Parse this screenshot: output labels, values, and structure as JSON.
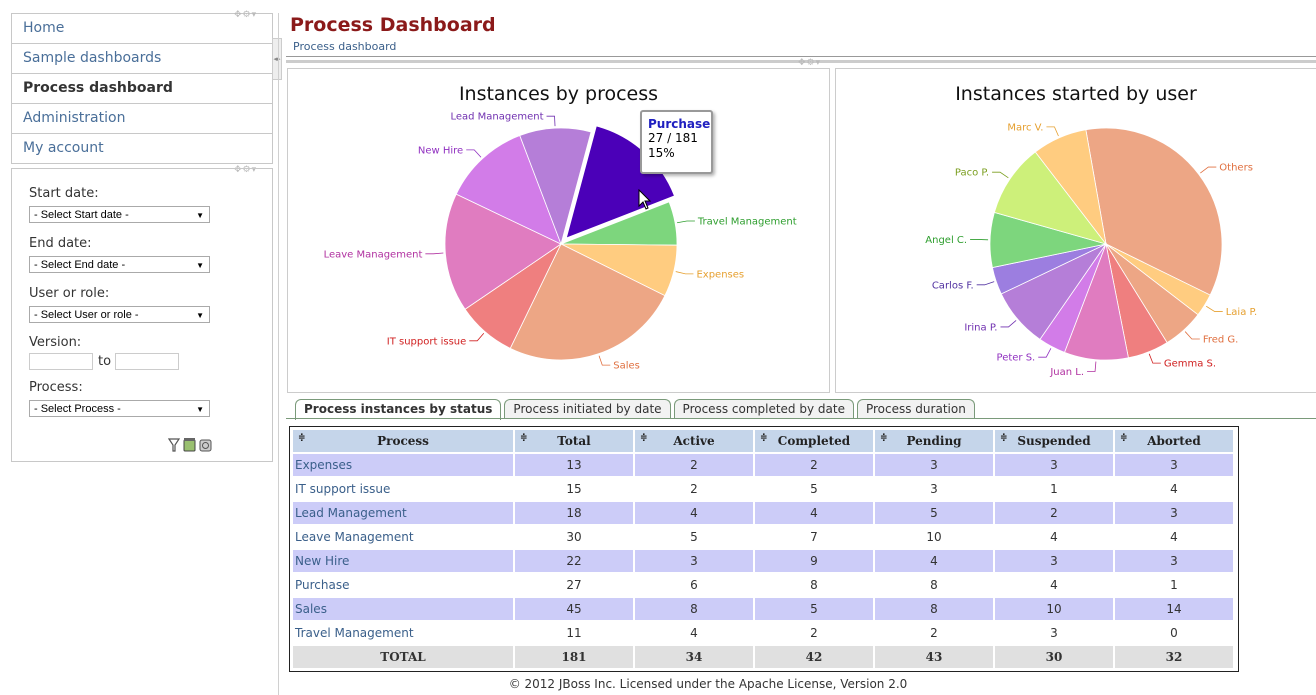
{
  "nav": {
    "items": [
      {
        "label": "Home",
        "active": false
      },
      {
        "label": "Sample dashboards",
        "active": false
      },
      {
        "label": "Process dashboard",
        "active": true
      },
      {
        "label": "Administration",
        "active": false
      },
      {
        "label": "My account",
        "active": false
      }
    ]
  },
  "filters": {
    "start_label": "Start date:",
    "start_value": "- Select Start date -",
    "end_label": "End date:",
    "end_value": "- Select End date -",
    "user_label": "User or role:",
    "user_value": "- Select User or role -",
    "version_label": "Version:",
    "version_to": "to",
    "process_label": "Process:",
    "process_value": "- Select Process -"
  },
  "header": {
    "title": "Process Dashboard",
    "breadcrumb": "Process dashboard"
  },
  "chart_data": [
    {
      "type": "pie",
      "title": "Instances by process",
      "slices": [
        {
          "label": "Purchase",
          "value": 27,
          "color": "#4b00b8"
        },
        {
          "label": "Travel Management",
          "value": 11,
          "color": "#7dd67d"
        },
        {
          "label": "Expenses",
          "value": 13,
          "color": "#ffcc80"
        },
        {
          "label": "Sales",
          "value": 45,
          "color": "#eda685"
        },
        {
          "label": "IT support issue",
          "value": 15,
          "color": "#ef7f7f"
        },
        {
          "label": "Leave Management",
          "value": 30,
          "color": "#e07cc0"
        },
        {
          "label": "New Hire",
          "value": 22,
          "color": "#d27ce8"
        },
        {
          "label": "Lead Management",
          "value": 18,
          "color": "#b57ed8"
        }
      ],
      "label_colors": {
        "Purchase": "#4b00b8",
        "Travel Management": "#2e9e2e",
        "Expenses": "#e6a030",
        "Sales": "#e07040",
        "IT support issue": "#d02020",
        "Leave Management": "#b030a0",
        "New Hire": "#9030c0",
        "Lead Management": "#7030b0"
      },
      "tooltip": {
        "title": "Purchase",
        "value": "27 / 181",
        "percent": "15%"
      }
    },
    {
      "type": "pie",
      "title": "Instances started by user",
      "slices": [
        {
          "label": "Others",
          "value": 55,
          "color": "#eda685"
        },
        {
          "label": "Laia P.",
          "value": 5,
          "color": "#ffcc80"
        },
        {
          "label": "Fred G.",
          "value": 9,
          "color": "#eda685"
        },
        {
          "label": "Gemma S.",
          "value": 9,
          "color": "#ef7f7f"
        },
        {
          "label": "Juan L.",
          "value": 14,
          "color": "#e07cc0"
        },
        {
          "label": "Peter S.",
          "value": 6,
          "color": "#d27ce8"
        },
        {
          "label": "Irina P.",
          "value": 13,
          "color": "#b57ed8"
        },
        {
          "label": "Carlos F.",
          "value": 6,
          "color": "#9c7ee0"
        },
        {
          "label": "Angel C.",
          "value": 12,
          "color": "#7dd67d"
        },
        {
          "label": "Paco P.",
          "value": 16,
          "color": "#cdf07a"
        },
        {
          "label": "Marc V.",
          "value": 12,
          "color": "#ffcc80"
        }
      ],
      "label_colors": {
        "Others": "#e07040",
        "Laia P.": "#e6a030",
        "Fred G.": "#e07040",
        "Gemma S.": "#d02020",
        "Juan L.": "#b030a0",
        "Peter S.": "#9030c0",
        "Irina P.": "#7030b0",
        "Carlos F.": "#5030a0",
        "Angel C.": "#2e9e2e",
        "Paco P.": "#7a9e1e",
        "Marc V.": "#e6a030"
      }
    }
  ],
  "tabs": [
    {
      "label": "Process instances by status",
      "active": true
    },
    {
      "label": "Process initiated by date",
      "active": false
    },
    {
      "label": "Process completed by date",
      "active": false
    },
    {
      "label": "Process duration",
      "active": false
    }
  ],
  "table": {
    "sort_glyph": "≑",
    "columns": [
      "Process",
      "Total",
      "Active",
      "Completed",
      "Pending",
      "Suspended",
      "Aborted"
    ],
    "rows": [
      [
        "Expenses",
        "13",
        "2",
        "2",
        "3",
        "3",
        "3"
      ],
      [
        "IT support issue",
        "15",
        "2",
        "5",
        "3",
        "1",
        "4"
      ],
      [
        "Lead Management",
        "18",
        "4",
        "4",
        "5",
        "2",
        "3"
      ],
      [
        "Leave Management",
        "30",
        "5",
        "7",
        "10",
        "4",
        "4"
      ],
      [
        "New Hire",
        "22",
        "3",
        "9",
        "4",
        "3",
        "3"
      ],
      [
        "Purchase",
        "27",
        "6",
        "8",
        "8",
        "4",
        "1"
      ],
      [
        "Sales",
        "45",
        "8",
        "5",
        "8",
        "10",
        "14"
      ],
      [
        "Travel Management",
        "11",
        "4",
        "2",
        "2",
        "3",
        "0"
      ]
    ],
    "total": [
      "TOTAL",
      "181",
      "34",
      "42",
      "43",
      "30",
      "32"
    ]
  },
  "footer": "© 2012 JBoss Inc. Licensed under the Apache License, Version 2.0"
}
